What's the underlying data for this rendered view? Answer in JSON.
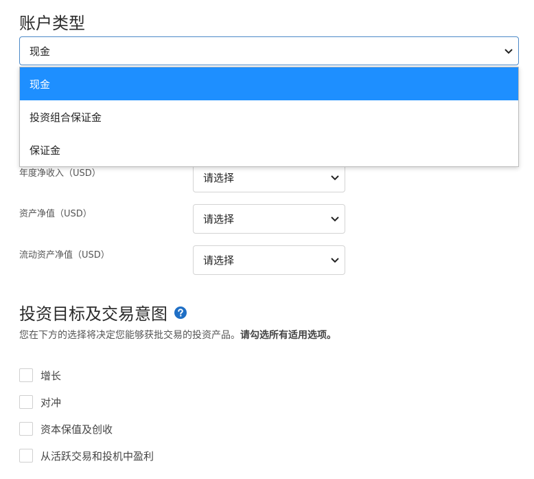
{
  "account_type": {
    "title": "账户类型",
    "selected_value": "现金",
    "options": [
      "现金",
      "投资组合保证金",
      "保证金"
    ]
  },
  "financials": [
    {
      "label": "年度净收入（USD）",
      "value": "请选择"
    },
    {
      "label": "资产净值（USD）",
      "value": "请选择"
    },
    {
      "label": "流动资产净值（USD）",
      "value": "请选择"
    }
  ],
  "objectives": {
    "title": "投资目标及交易意图",
    "help_icon": "question-circle-icon",
    "description_prefix": "您在下方的选择将决定您能够获批交易的投资产品。",
    "description_bold": "请勾选所有适用选项。",
    "options": [
      "增长",
      "对冲",
      "资本保值及创收",
      "从活跃交易和投机中盈利"
    ]
  },
  "colors": {
    "accent": "#1e8fff",
    "focus_border": "#4a88c7",
    "help_icon": "#1f6fc5"
  }
}
